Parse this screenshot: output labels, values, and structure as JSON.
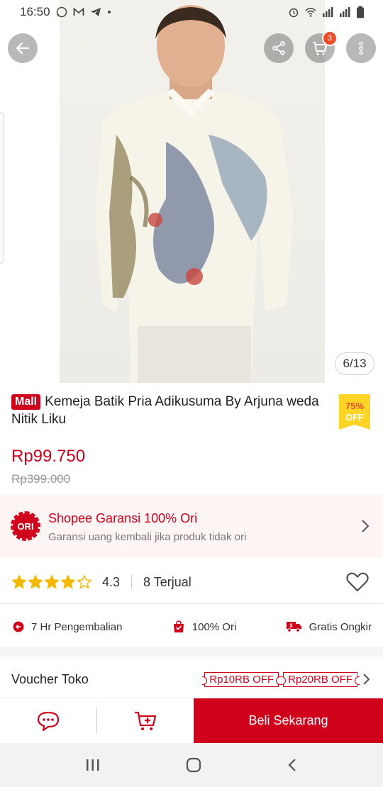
{
  "status_bar": {
    "time": "16:50",
    "left_icons": [
      "whatsapp-icon",
      "gmail-icon",
      "telegram-icon",
      "dot-icon"
    ],
    "right_icons": [
      "alarm-icon",
      "wifi-icon",
      "signal-icon",
      "signal-icon",
      "battery-icon"
    ]
  },
  "hero": {
    "cart_count": "3",
    "image_counter": "6/13"
  },
  "product": {
    "mall_badge": "Mall",
    "title": "Kemeja Batik Pria Adikusuma By Arjuna weda Nitik Liku",
    "discount_pct": "75%",
    "discount_off": "OFF",
    "price": "Rp99.750",
    "old_price": "Rp399.000"
  },
  "guarantee": {
    "badge": "ORI",
    "title": "Shopee Garansi 100% Ori",
    "subtitle": "Garansi uang kembali jika produk tidak ori"
  },
  "rating": {
    "stars_filled": 4,
    "stars_total": 5,
    "value": "4.3",
    "sold": "8 Terjual"
  },
  "policies": [
    {
      "icon": "return-icon",
      "label": "7 Hr Pengembalian"
    },
    {
      "icon": "shield-bag-icon",
      "label": "100% Ori"
    },
    {
      "icon": "truck-icon",
      "label": "Gratis Ongkir"
    }
  ],
  "voucher": {
    "label": "Voucher Toko",
    "chips": [
      "Rp10RB OFF",
      "Rp20RB OFF"
    ]
  },
  "actions": {
    "buy_now": "Beli Sekarang"
  },
  "colors": {
    "brand_red": "#d0011b",
    "shopee_orange": "#ee4d2d",
    "discount_yellow": "#ffd424",
    "star_yellow": "#f5b800"
  }
}
